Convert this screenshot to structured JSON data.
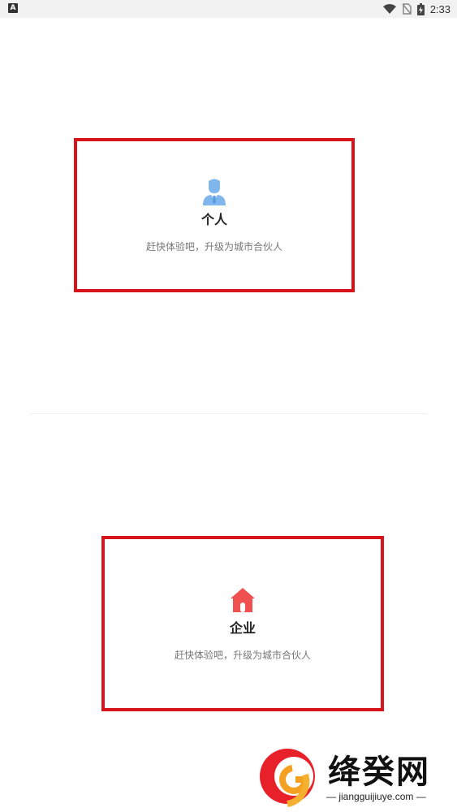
{
  "status_bar": {
    "left_icon_letter": "A",
    "time": "2:33"
  },
  "cards": [
    {
      "id": "personal",
      "title": "个人",
      "subtitle": "赶快体验吧，升级为城市合伙人",
      "icon": "person-icon",
      "icon_color": "#7fb6ee"
    },
    {
      "id": "enterprise",
      "title": "企业",
      "subtitle": "赶快体验吧，升级为城市合伙人",
      "icon": "house-icon",
      "icon_color": "#f05050"
    }
  ],
  "colors": {
    "highlight_border": "#d9131a",
    "divider": "#eeeeee"
  },
  "watermark": {
    "name": "绛癸网",
    "url": "jiangguijiuye.com"
  }
}
